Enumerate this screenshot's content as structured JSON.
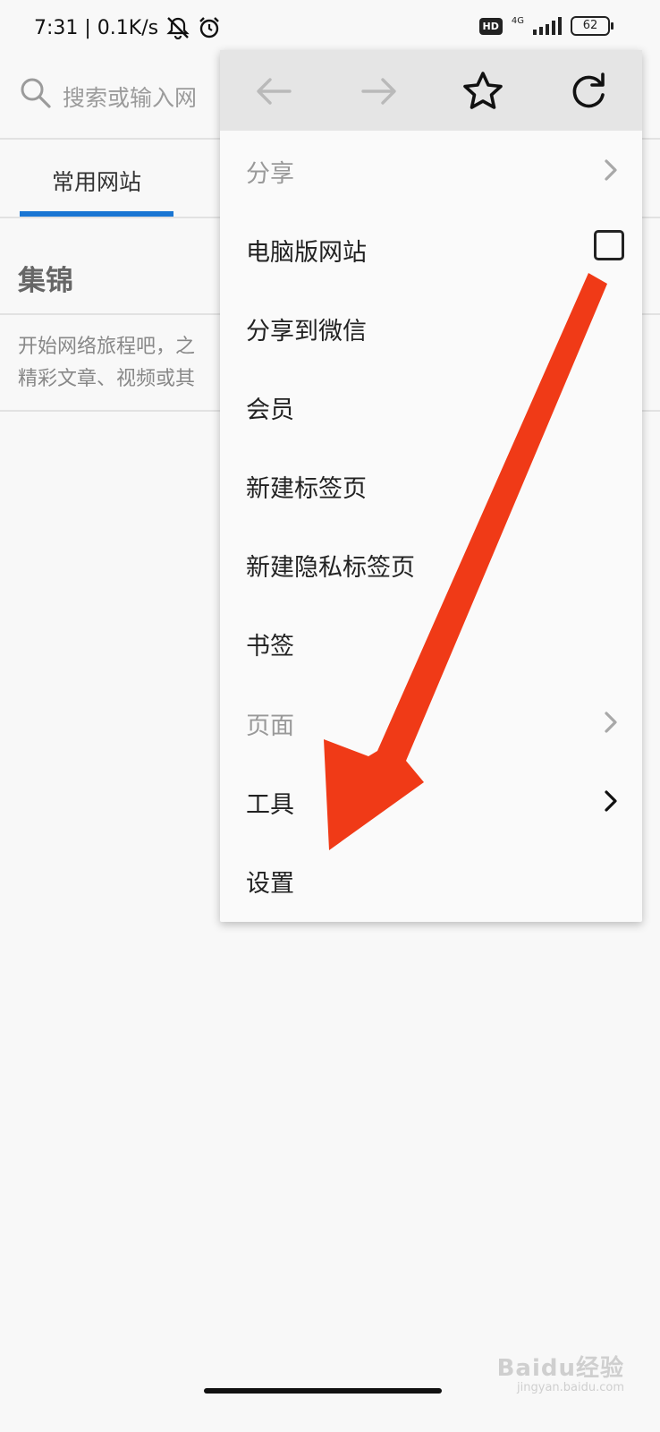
{
  "status_bar": {
    "time_speed": "7:31 | 0.1K/s",
    "hd": "HD",
    "network": "4G",
    "battery": "62",
    "icons": [
      "mute-icon",
      "alarm-icon",
      "signal-icon",
      "battery-icon"
    ]
  },
  "search": {
    "placeholder": "搜索或输入网"
  },
  "tabs": [
    {
      "label": "常用网站",
      "active": true
    }
  ],
  "section": {
    "title": "集锦",
    "description_line1": "开始网络旅程吧，之",
    "description_line2": "精彩文章、视频或其"
  },
  "menu": {
    "toolbar": [
      "back-icon",
      "forward-icon",
      "star-icon",
      "refresh-icon"
    ],
    "items": [
      {
        "label": "分享",
        "disabled": true,
        "chevron": true
      },
      {
        "label": "电脑版网站",
        "checkbox": true
      },
      {
        "label": "分享到微信"
      },
      {
        "label": "会员"
      },
      {
        "label": "新建标签页"
      },
      {
        "label": "新建隐私标签页"
      },
      {
        "label": "书签"
      },
      {
        "label": "页面",
        "disabled": true,
        "chevron": true
      },
      {
        "label": "工具",
        "chevron": true
      },
      {
        "label": "设置"
      }
    ]
  },
  "watermark": {
    "text": "Baidu经验",
    "sub": "jingyan.baidu.com"
  },
  "colors": {
    "accent": "#1a76d3",
    "annotation_arrow": "#f03a17"
  }
}
